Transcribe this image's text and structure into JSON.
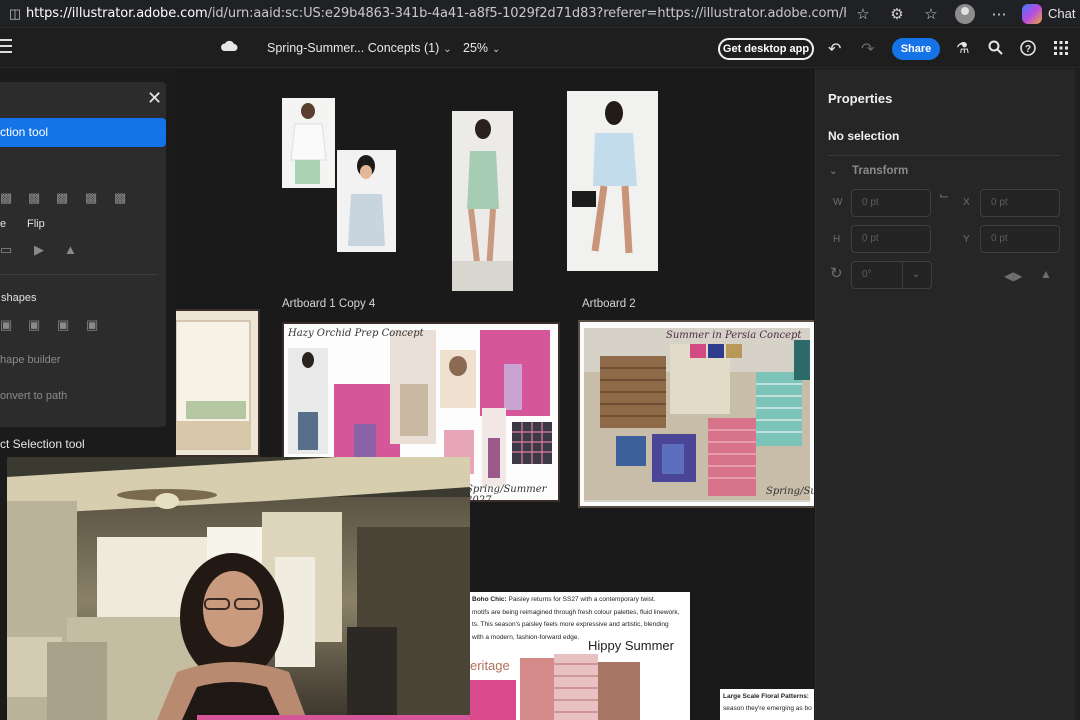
{
  "browser": {
    "url_host": "https://illustrator.adobe.com",
    "url_rest": "/id/urn:aaid:sc:US:e29b4863-341b-4a41-a8f5-1029f2d71d83?referer=https://illustrator.adobe.com/home?promoid=...",
    "chat_label": "Chat"
  },
  "header": {
    "doc_title": "Spring-Summer... Concepts (1)",
    "zoom": "25%",
    "desktop_label": "Get desktop app",
    "share_label": "Share"
  },
  "tool_panel": {
    "selected_tool": "ction tool",
    "flip_label": "Flip",
    "e_label": "e",
    "shapes_label": "shapes",
    "shape_builder_label": "hape builder",
    "convert_label": "onvert to path",
    "direct_selection_label": "ct Selection tool"
  },
  "canvas": {
    "artboard_copy4_label": "Artboard 1 Copy 4",
    "artboard2_label": "Artboard 2",
    "orchid_title": "Hazy Orchid Prep Concept",
    "orchid_footer": "Spring/Summer 2027",
    "persia_title": "Summer in Persia Concept",
    "persia_footer": "Spring/Sum",
    "boho_bold": "Boho Chic:",
    "boho_line1": " Paisley returns for SS27 with a contemporary twist.",
    "boho_line2": "motifs are being reimagined through fresh colour palettes, fluid linework,",
    "boho_line3": "ts. This season's paisley feels more expressive and artistic, blending",
    "boho_line4": "with a modern, fashion-forward edge.",
    "hippy_title": "Hippy Summer",
    "heritage_text": "eritage",
    "floral_bold": "Large Scale Floral Patterns:",
    "floral_line1": "season they're emerging as bo"
  },
  "properties": {
    "title": "Properties",
    "selection": "No selection",
    "transform_label": "Transform",
    "w_label": "W",
    "h_label": "H",
    "x_label": "X",
    "y_label": "Y",
    "w_value": "0 pt",
    "h_value": "0 pt",
    "x_value": "0 pt",
    "y_value": "0 pt",
    "rotate_value": "0°"
  },
  "colors": {
    "accent": "#1473e6",
    "canvas": "#1a1a1a",
    "panel": "#262626",
    "orchid_pink": "#d6569a",
    "persia_teal": "#5aa7a1"
  }
}
